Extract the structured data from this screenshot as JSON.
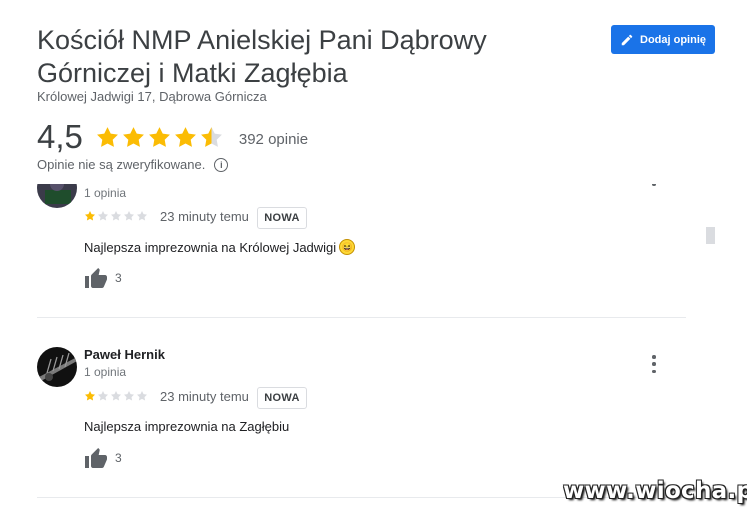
{
  "place": {
    "title": "Kościół NMP Anielskiej Pani Dąbrowy Górniczej i Matki Zagłębia",
    "address": "Królowej Jadwigi 17, Dąbrowa Górnicza",
    "rating": "4,5",
    "rating_fraction": 0.9,
    "review_count_text": "392 opinie",
    "verification_note": "Opinie nie są zweryfikowane.",
    "info_symbol": "i"
  },
  "header": {
    "add_review_label": "Dodaj opinię",
    "add_review_icon": "pencil-icon"
  },
  "colors": {
    "accent": "#1a73e8",
    "star_filled": "#fbbc04",
    "star_empty": "#dadce0"
  },
  "reviews": [
    {
      "name": "",
      "meta": "1 opinia",
      "stars": 1,
      "time": "23 minuty temu",
      "badge": "NOWA",
      "text": "Najlepsza imprezownia na Królowej Jadwigi",
      "has_emoji": true,
      "likes": "3"
    },
    {
      "name": "Paweł Hernik",
      "meta": "1 opinia",
      "stars": 1,
      "time": "23 minuty temu",
      "badge": "NOWA",
      "text": "Najlepsza imprezownia na Zagłębiu",
      "has_emoji": false,
      "likes": "3"
    }
  ],
  "watermark": "www.wiocha.pl"
}
